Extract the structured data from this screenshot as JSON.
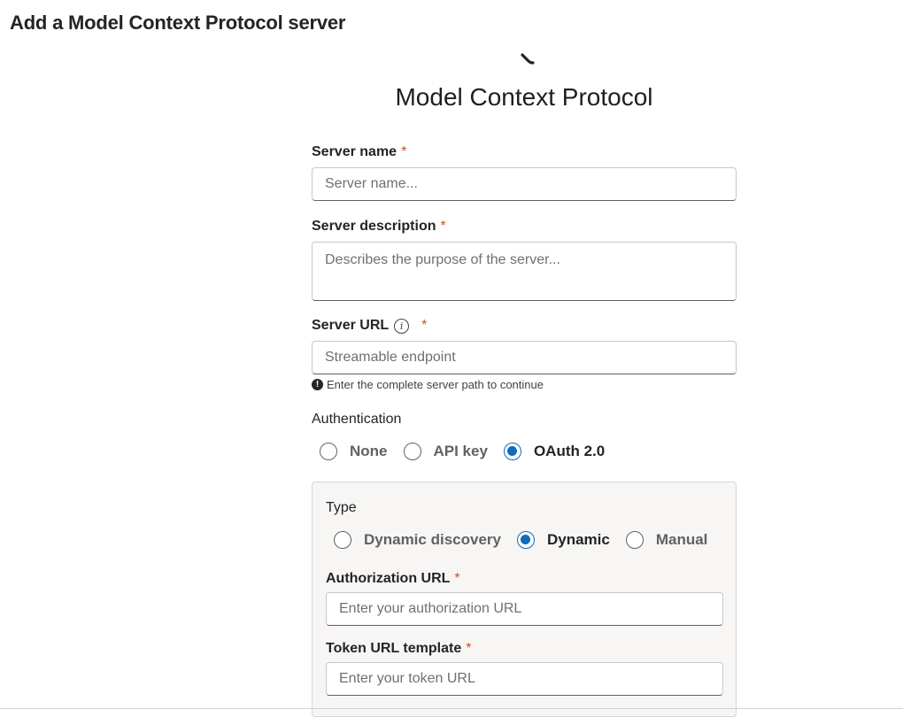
{
  "header": {
    "title": "Add a Model Context Protocol server"
  },
  "hero": {
    "title": "Model Context Protocol"
  },
  "form": {
    "server_name": {
      "label": "Server name",
      "required_mark": "*",
      "placeholder": "Server name...",
      "value": ""
    },
    "server_description": {
      "label": "Server description",
      "required_mark": "*",
      "placeholder": "Describes the purpose of the server...",
      "value": ""
    },
    "server_url": {
      "label": "Server URL",
      "info_icon": "info-icon",
      "required_mark": "*",
      "placeholder": "Streamable endpoint",
      "value": "",
      "helper_text": "Enter the complete server path to continue",
      "helper_icon": "alert-icon"
    },
    "authentication": {
      "label": "Authentication",
      "options": [
        {
          "label": "None",
          "selected": false
        },
        {
          "label": "API key",
          "selected": false
        },
        {
          "label": "OAuth 2.0",
          "selected": true
        }
      ]
    },
    "oauth": {
      "type_label": "Type",
      "type_options": [
        {
          "label": "Dynamic discovery",
          "selected": false
        },
        {
          "label": "Dynamic",
          "selected": true
        },
        {
          "label": "Manual",
          "selected": false
        }
      ],
      "authorization_url": {
        "label": "Authorization URL",
        "required_mark": "*",
        "placeholder": "Enter your authorization URL",
        "value": ""
      },
      "token_url": {
        "label": "Token URL template",
        "required_mark": "*",
        "placeholder": "Enter your token URL",
        "value": ""
      }
    }
  },
  "colors": {
    "accent": "#0f6cbd",
    "required": "#c4541b",
    "panel_bg": "#f7f6f5"
  }
}
